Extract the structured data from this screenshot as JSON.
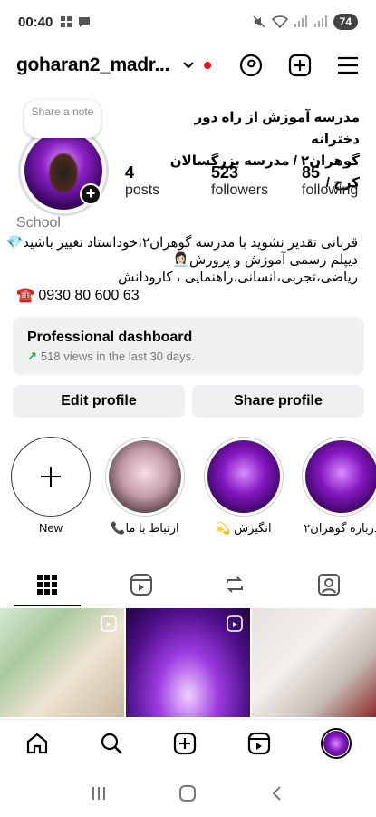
{
  "status": {
    "time": "00:40",
    "battery": "74"
  },
  "header": {
    "username": "goharan2_madr..."
  },
  "profile": {
    "note": "Share a note",
    "fullname_line1": "مدرسه آموزش از راه دور دخترانه",
    "fullname_line2": "گوهران۲ / مدرسه بزرگسالان کرج /",
    "posts_count": "4",
    "posts_label": "posts",
    "followers_count": "523",
    "followers_label": "followers",
    "following_count": "85",
    "following_label": "following",
    "category": "School",
    "bio_line1": "قربانی تقدیر نشوید با مدرسه گوهران۲،خوداستاد تغییر باشید💎",
    "bio_line2": "دیپلم رسمی آموزش و پرورش👩🏻‍💼",
    "bio_line3": "ریاضی،تجربی،انسانی،راهنمایی ، کارودانش",
    "phone": "☎️ 0930 80 600 63"
  },
  "dashboard": {
    "title": "Professional dashboard",
    "subtitle": "518 views in the last 30 days."
  },
  "buttons": {
    "edit": "Edit profile",
    "share": "Share profile"
  },
  "highlights": [
    {
      "label": "New"
    },
    {
      "label": "ارتباط با ما📞"
    },
    {
      "label": "انگیزش 💫"
    },
    {
      "label": "درباره گوهران۲"
    }
  ],
  "colors": {
    "accent_purple": "#8417c0",
    "growth_green": "#1aa34a",
    "notification_red": "#e11111"
  }
}
